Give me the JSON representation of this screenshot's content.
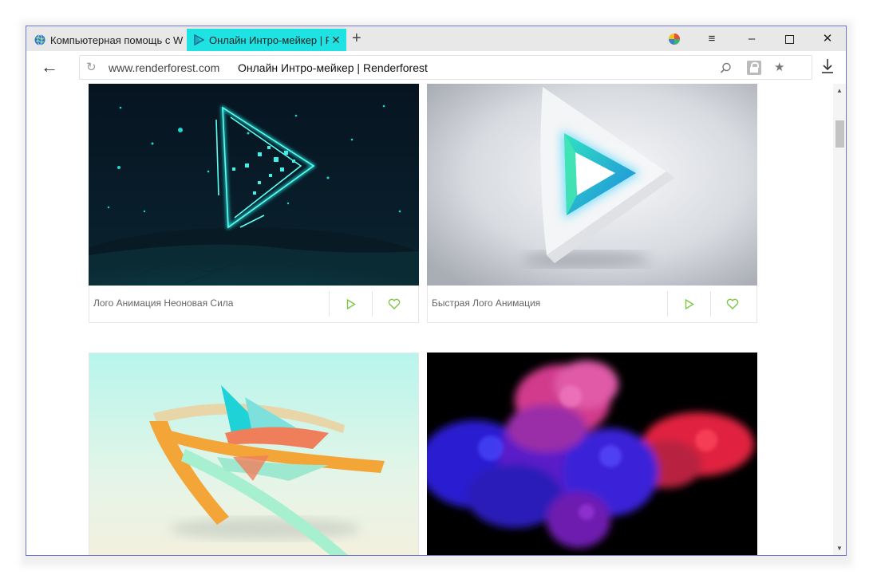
{
  "tabs": [
    {
      "label": "Компьютерная помощь с W",
      "icon": "globe-icon",
      "active": false
    },
    {
      "label": "Онлайн Интро-мейкер | Renderforest",
      "icon": "renderforest-icon",
      "active": true
    }
  ],
  "address_bar": {
    "domain": "www.renderforest.com",
    "page_title": "Онлайн Интро-мейкер | Renderforest"
  },
  "cards": [
    {
      "label": "Лого Анимация Неоновая Сила",
      "thumb": "neon-play-thumbnail"
    },
    {
      "label": "Быстрая Лого Анимация",
      "thumb": "white-play-thumbnail"
    },
    {
      "label": "",
      "thumb": "ribbons-thumbnail"
    },
    {
      "label": "",
      "thumb": "smoke-thumbnail"
    }
  ],
  "colors": {
    "active_tab": "#1fe3e3",
    "accent_green": "#7ac943",
    "window_border": "#6f78c9"
  }
}
